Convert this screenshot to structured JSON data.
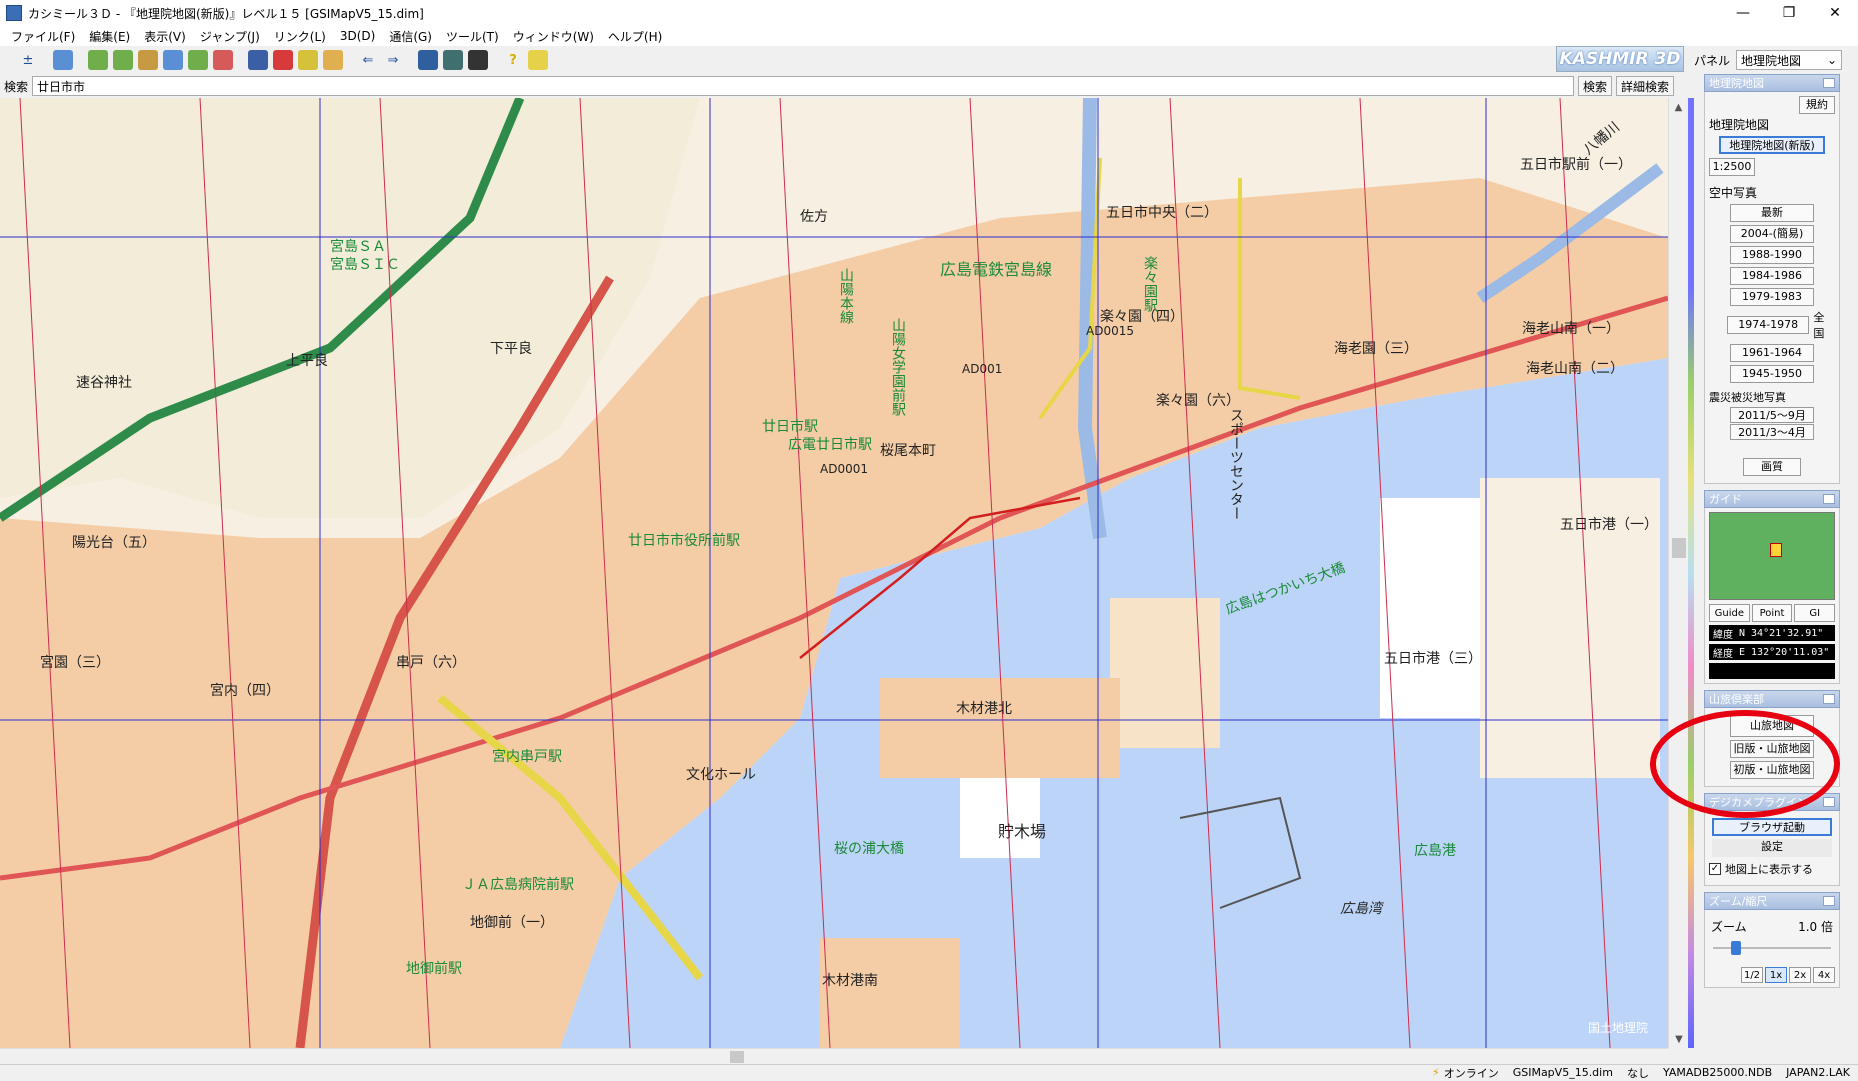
{
  "window": {
    "title": "カシミール３Ｄ - 『地理院地図(新版)』レベル１５ [GSIMapV5_15.dim]",
    "controls": [
      "—",
      "❐",
      "✕"
    ]
  },
  "menu": [
    "ファイル(F)",
    "編集(E)",
    "表示(V)",
    "ジャンプ(J)",
    "リンク(L)",
    "3D(D)",
    "通信(G)",
    "ツール(T)",
    "ウィンドウ(W)",
    "ヘルプ(H)"
  ],
  "brand": "KASHMIR 3D",
  "panel_select": {
    "label": "パネル",
    "value": "地理院地図"
  },
  "search": {
    "label": "検索",
    "value": "廿日市市",
    "search_button": "検索",
    "detail_button": "詳細検索"
  },
  "map": {
    "copyright": "国土地理院",
    "labels": {
      "l1": "宮島ＳＡ",
      "l2": "宮島ＳＩＣ",
      "l3": "上平良",
      "l4": "下平良",
      "l5": "速谷神社",
      "l6": "陽光台（五）",
      "l7": "宮園（三）",
      "l8": "宮内（四）",
      "l9": "宮内串戸駅",
      "l10": "廿日市駅",
      "l11": "広電廿日市駅",
      "l12": "廿日市市役所前駅",
      "l13": "広島電鉄宮島線",
      "l14": "山陽本線",
      "l15": "五日市中央（二）",
      "l16": "楽々園（四）",
      "l17": "楽々園（六）",
      "l18": "海老園（三）",
      "l19": "海老山南（一）",
      "l20": "海老山南（二）",
      "l21": "五日市港（一）",
      "l22": "五日市港（三）",
      "l23": "広島はつかいち大橋",
      "l24": "木材港北",
      "l25": "木材港南",
      "l26": "貯木場",
      "l27": "広島港",
      "l28": "広島湾",
      "l29": "桜の浦大橋",
      "l30": "ＪＡ広島病院前駅",
      "l31": "地御前（一）",
      "l32": "地御前駅",
      "l33": "桜尾本町",
      "l34": "スポーツセンター",
      "l35": "楽々園駅",
      "l36": "山陽女学園前駅",
      "l37": "佐方",
      "l38": "串戸（六）",
      "l39": "文化ホール",
      "l40": "AD0001",
      "l41": "AD001",
      "l42": "AD0015",
      "l43": "五日市駅前（一）",
      "l44": "八幡川"
    }
  },
  "sidepanel": {
    "section1": {
      "title": "地理院地図",
      "rules_button": "規約",
      "label": "地理院地図",
      "selected_button": "地理院地図(新版)",
      "scale_button": "1:2500",
      "aerial_label": "空中写真",
      "aerial_buttons": [
        "最新",
        "2004-(簡易)",
        "1988-1990",
        "1984-1986",
        "1979-1983",
        "1974-1978",
        "1961-1964",
        "1945-1950"
      ],
      "national_label": "全国",
      "disaster_label": "震災被災地写真",
      "disaster_buttons": [
        "2011/5～9月",
        "2011/3～4月"
      ],
      "quality_button": "画質"
    },
    "section2": {
      "title": "ガイド",
      "tabs": [
        "Guide",
        "Point",
        "GI"
      ],
      "lat_label": "緯度",
      "lat_value": "N 34°21'32.91\"",
      "lon_label": "経度",
      "lon_value": "E 132°20'11.03\""
    },
    "section3": {
      "title": "山旅倶楽部",
      "buttons": [
        "山旅地図",
        "旧版・山旅地図",
        "初版・山旅地図"
      ]
    },
    "section4": {
      "title": "デジカメプラグイン",
      "browser_button": "ブラウザ起動",
      "settings_button": "設定",
      "checkbox_label": "地図上に表示する"
    },
    "section5": {
      "title": "ズーム/縮尺",
      "zoom_label": "ズーム",
      "zoom_value": "1.0 倍",
      "zoom_level": 0.15,
      "zoom_buttons": [
        "1/2",
        "1x",
        "2x",
        "4x"
      ]
    }
  },
  "status": {
    "online": "オンライン",
    "dim": "GSIMapV5_15.dim",
    "none": "なし",
    "db1": "YAMADB25000.NDB",
    "db2": "JAPAN2.LAK"
  }
}
